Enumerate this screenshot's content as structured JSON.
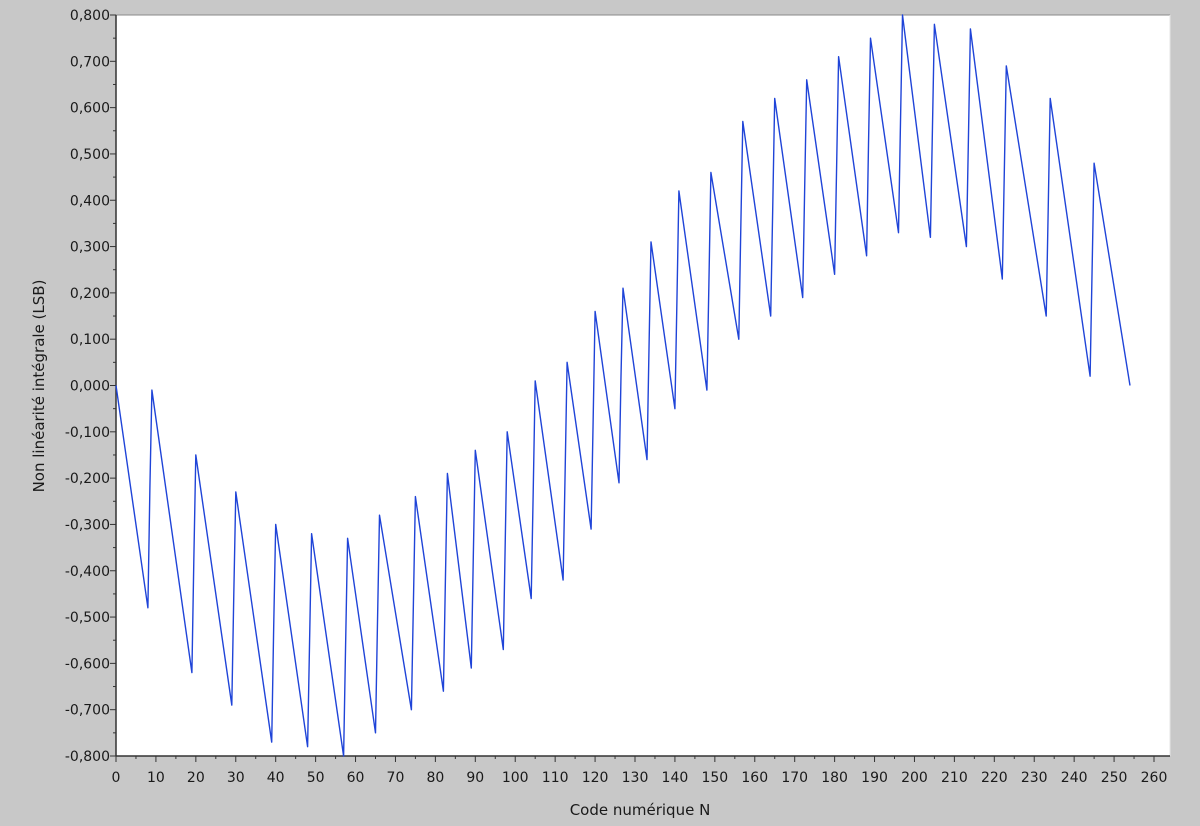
{
  "colors": {
    "frame": "#c8c8c8",
    "plot_background": "#ffffff",
    "series": "#1f44d8",
    "axis": "#333333"
  },
  "chart_data": {
    "type": "line",
    "title": "",
    "xlabel": "Code numérique N",
    "ylabel": "Non linéarité intégrale (LSB)",
    "xlim": [
      0,
      260
    ],
    "ylim": [
      -0.8,
      0.8
    ],
    "grid": false,
    "legend": "none",
    "x_ticks": [
      0,
      10,
      20,
      30,
      40,
      50,
      60,
      70,
      80,
      90,
      100,
      110,
      120,
      130,
      140,
      150,
      160,
      170,
      180,
      190,
      200,
      210,
      220,
      230,
      240,
      250,
      260
    ],
    "x_tick_labels": [
      "0",
      "10",
      "20",
      "30",
      "40",
      "50",
      "60",
      "70",
      "80",
      "90",
      "100",
      "110",
      "120",
      "130",
      "140",
      "150",
      "160",
      "170",
      "180",
      "190",
      "200",
      "210",
      "220",
      "230",
      "240",
      "250",
      "260"
    ],
    "y_ticks": [
      0.8,
      0.7,
      0.6,
      0.5,
      0.4,
      0.3,
      0.2,
      0.1,
      0.0,
      -0.1,
      -0.2,
      -0.3,
      -0.4,
      -0.5,
      -0.6,
      -0.7,
      -0.8
    ],
    "y_tick_labels": [
      "0,800",
      "0,700",
      "0,600",
      "0,500",
      "0,400",
      "0,300",
      "0,200",
      "0,100",
      "0,000",
      "-0,100",
      "-0,200",
      "-0,300",
      "-0,400",
      "-0,500",
      "-0,600",
      "-0,700",
      "-0,800"
    ],
    "series": [
      {
        "x": [
          0,
          8,
          8.5,
          9,
          19,
          19.5,
          20,
          29,
          29.5,
          30,
          39,
          39.5,
          40,
          48,
          48.5,
          49,
          57,
          57.5,
          58,
          65,
          65.5,
          66,
          74,
          74.5,
          75,
          82,
          82.5,
          83,
          89,
          89.5,
          90,
          97,
          97.5,
          98,
          104,
          104.5,
          105,
          112,
          112.5,
          113,
          119,
          119.5,
          120,
          126,
          126.5,
          127,
          133,
          133.5,
          134,
          140,
          140.5,
          141,
          148,
          148.5,
          149,
          156,
          156.5,
          157,
          164,
          164.5,
          165,
          172,
          172.5,
          173,
          180,
          180.5,
          181,
          188,
          188.5,
          189,
          196,
          196.5,
          197,
          204,
          204.5,
          205,
          213,
          213.5,
          214,
          222,
          222.5,
          223,
          233,
          233.5,
          234,
          244,
          244.5,
          245,
          254
        ],
        "y": [
          0.0,
          -0.48,
          -0.22,
          -0.01,
          -0.62,
          -0.38,
          -0.15,
          -0.69,
          -0.45,
          -0.23,
          -0.77,
          -0.52,
          -0.3,
          -0.78,
          -0.55,
          -0.32,
          -0.8,
          -0.56,
          -0.33,
          -0.75,
          -0.51,
          -0.28,
          -0.7,
          -0.47,
          -0.24,
          -0.66,
          -0.42,
          -0.19,
          -0.61,
          -0.37,
          -0.14,
          -0.57,
          -0.33,
          -0.1,
          -0.46,
          -0.23,
          0.01,
          -0.42,
          -0.19,
          0.05,
          -0.31,
          -0.08,
          0.16,
          -0.21,
          0.02,
          0.21,
          -0.16,
          0.08,
          0.31,
          -0.05,
          0.18,
          0.42,
          -0.01,
          0.22,
          0.46,
          0.1,
          0.34,
          0.57,
          0.15,
          0.38,
          0.62,
          0.19,
          0.43,
          0.66,
          0.24,
          0.47,
          0.71,
          0.28,
          0.52,
          0.75,
          0.33,
          0.57,
          0.8,
          0.32,
          0.55,
          0.78,
          0.3,
          0.53,
          0.77,
          0.23,
          0.46,
          0.69,
          0.15,
          0.38,
          0.62,
          0.02,
          0.25,
          0.48,
          0.0
        ]
      }
    ]
  }
}
